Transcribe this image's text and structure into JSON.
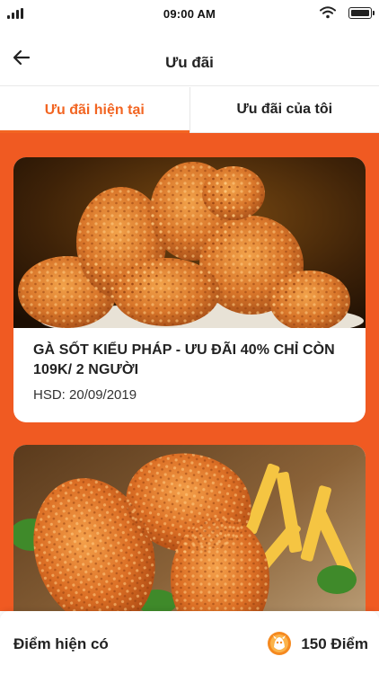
{
  "status_bar": {
    "time": "09:00 AM"
  },
  "header": {
    "title": "Ưu đãi",
    "back_icon": "arrow-left-icon"
  },
  "tabs": [
    {
      "label": "Ưu đãi hiện tại",
      "active": true
    },
    {
      "label": "Ưu đãi của tôi",
      "active": false
    }
  ],
  "offers": [
    {
      "title": "GÀ SỐT KIỂU PHÁP - ƯU ĐÃI 40% CHỈ CÒN 109K/ 2 NGƯỜI",
      "expiry": "HSD: 20/09/2019",
      "image": "fried-chicken-photo"
    },
    {
      "title": "",
      "expiry": "",
      "image": "fried-chicken-fries-photo"
    }
  ],
  "points": {
    "label": "Điểm hiện có",
    "value": "150 Điểm",
    "icon": "coin-mascot-icon"
  },
  "colors": {
    "accent": "#f26522",
    "background": "#f05a22"
  }
}
